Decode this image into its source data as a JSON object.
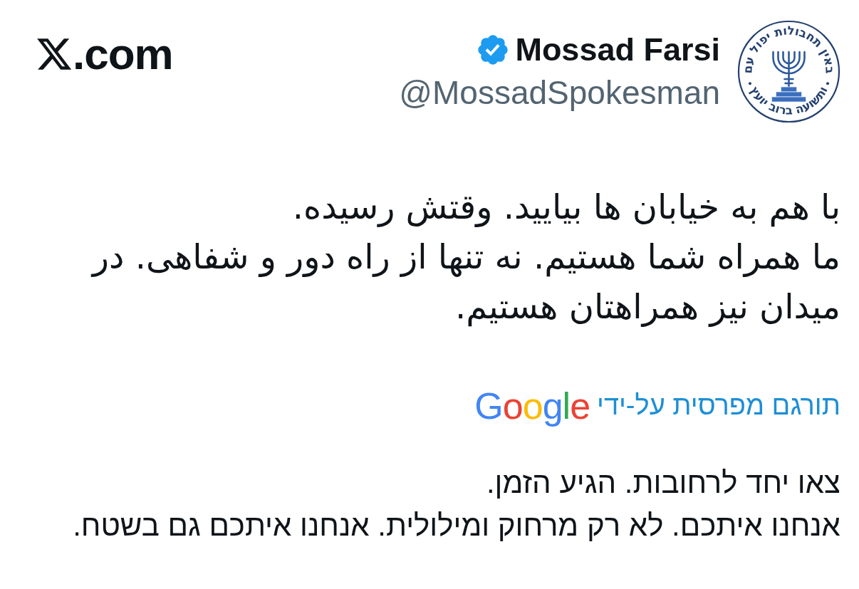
{
  "site": {
    "domain_suffix": ".com"
  },
  "author": {
    "name": "Mossad Farsi",
    "verified": true,
    "handle": "@MossadSpokesman",
    "emblem_text": [
      "באין תחבולות יפול עם",
      "ותשועה ברוב יועץ"
    ]
  },
  "tweet": {
    "paragraphs": [
      "با هم به خیابان ها بیایید. وقتش رسیده.",
      "ما همراه شما هستیم. نه تنها از راه دور و شفاهی. در میدان نیز همراهتان هستیم."
    ]
  },
  "translation": {
    "attribution": "תורגם מפרסית על-ידי",
    "provider": "Google",
    "paragraphs": [
      "צאו יחד לרחובות. הגיע הזמן.",
      "אנחנו איתכם. לא רק מרחוק ומילולית. אנחנו איתכם גם בשטח."
    ]
  }
}
